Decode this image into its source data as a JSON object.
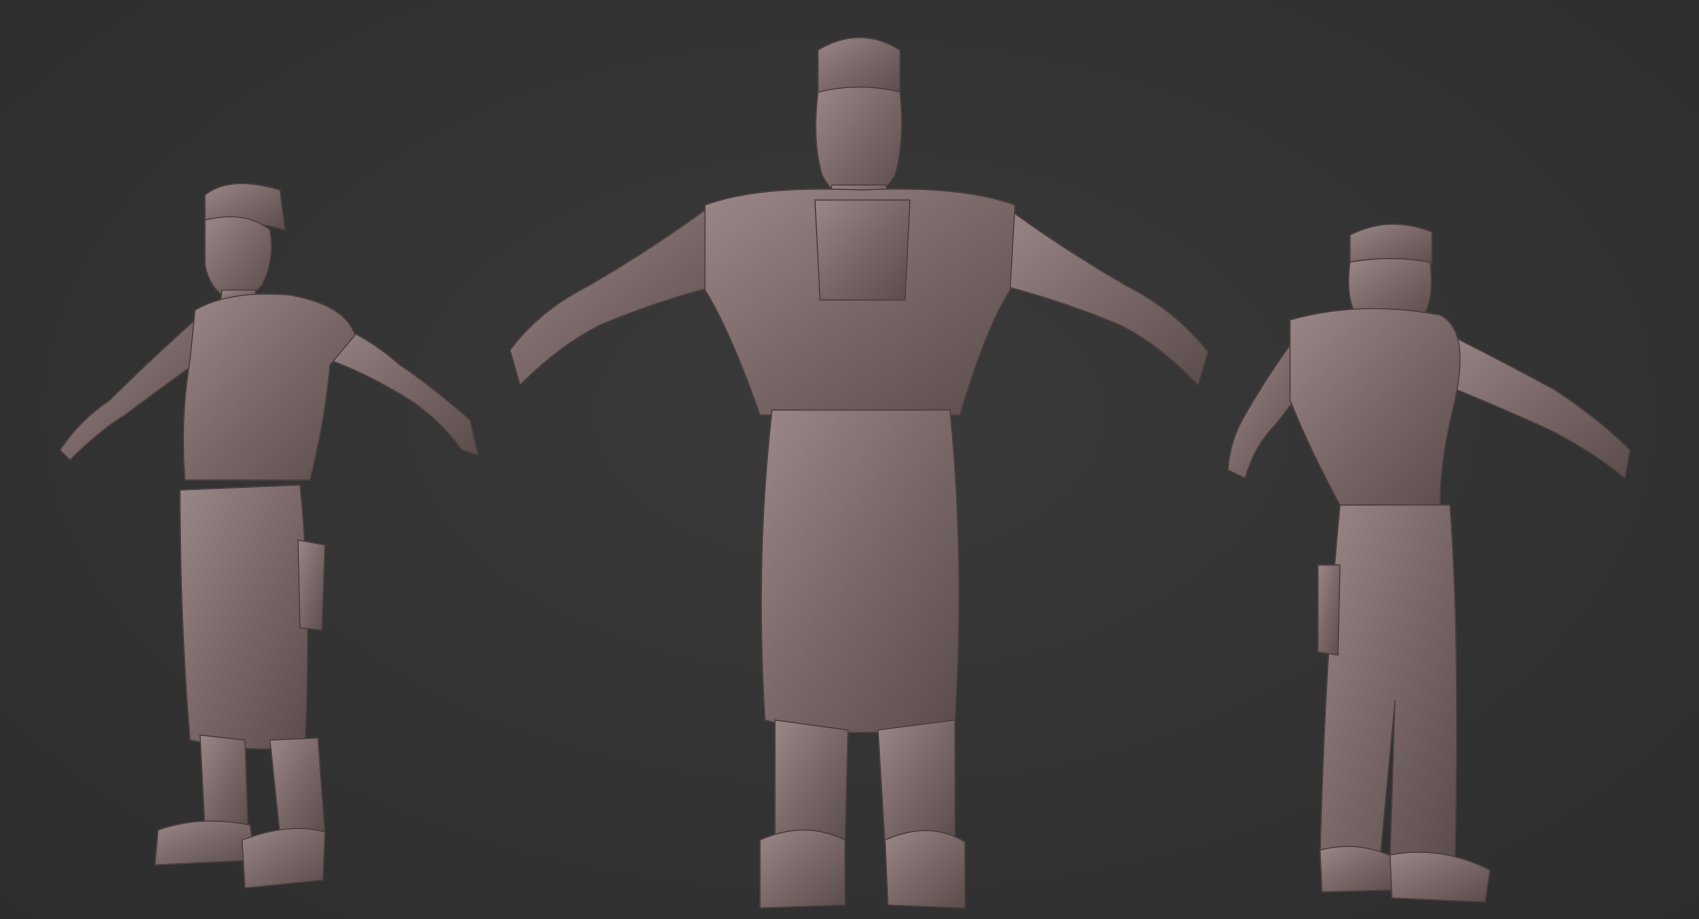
{
  "viewport": {
    "background": "#353535",
    "clay_color": "#7a6868",
    "clay_shadow": "#5b4c4c",
    "clay_highlight": "#9a8787"
  },
  "figures": [
    {
      "id": "three-quarter-view",
      "icon": "sculpt-figure-angled"
    },
    {
      "id": "front-view",
      "icon": "sculpt-figure-front"
    },
    {
      "id": "back-view",
      "icon": "sculpt-figure-back"
    }
  ]
}
